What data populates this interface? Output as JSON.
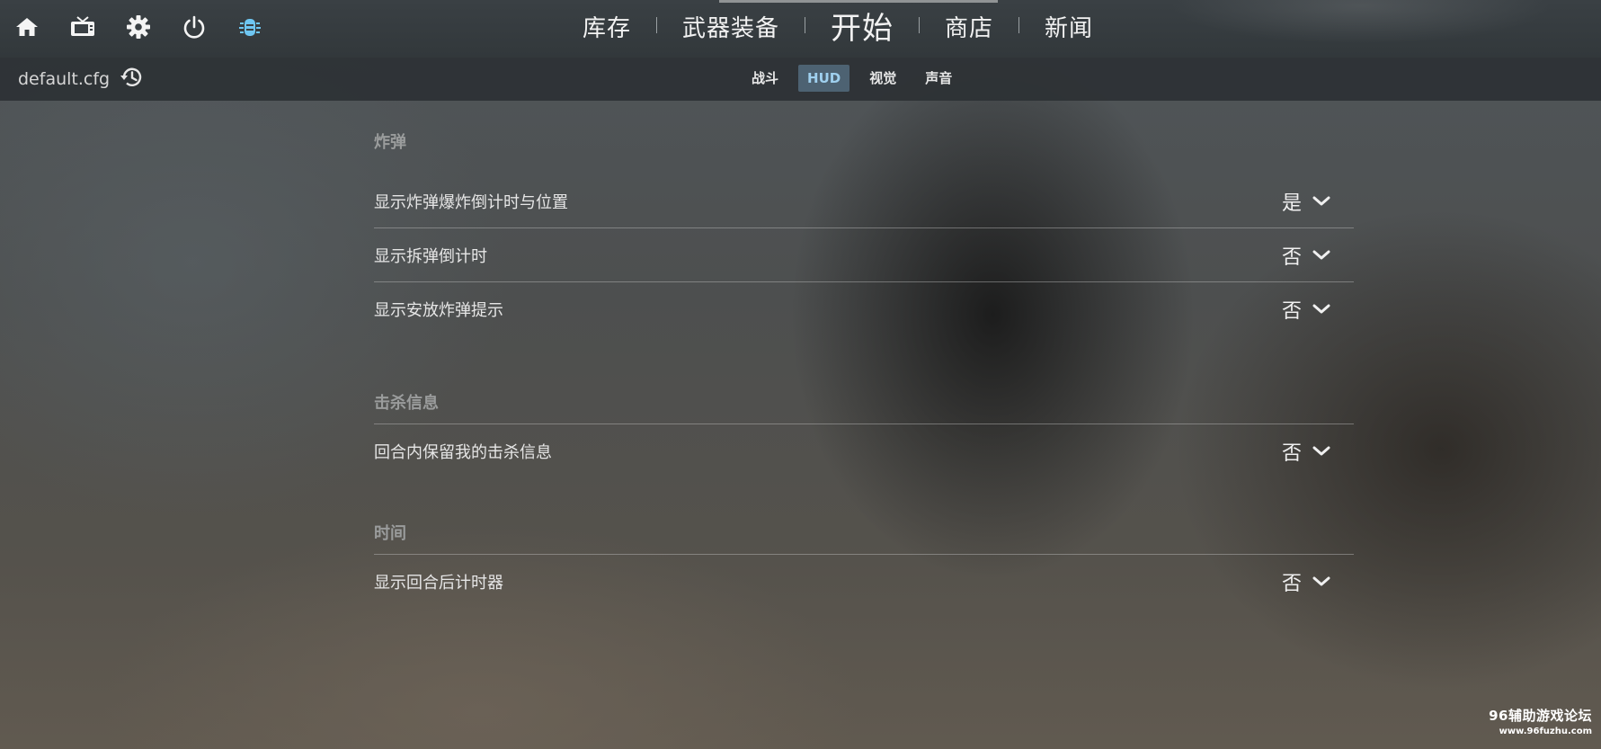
{
  "topbar": {
    "icons": [
      "home-icon",
      "tv-icon",
      "gear-icon",
      "power-icon",
      "bug-icon"
    ],
    "accent_color": "#6ec6f2",
    "nav": [
      {
        "label": "库存"
      },
      {
        "label": "武器装备"
      },
      {
        "label": "开始",
        "active": true
      },
      {
        "label": "商店"
      },
      {
        "label": "新闻"
      }
    ]
  },
  "subbar": {
    "config_name": "default.cfg",
    "tabs": [
      {
        "label": "战斗"
      },
      {
        "label": "HUD",
        "active": true
      },
      {
        "label": "视觉"
      },
      {
        "label": "声音"
      }
    ]
  },
  "sections": [
    {
      "title": "炸弹",
      "rows": [
        {
          "label": "显示炸弹爆炸倒计时与位置",
          "value": "是"
        },
        {
          "label": "显示拆弹倒计时",
          "value": "否"
        },
        {
          "label": "显示安放炸弹提示",
          "value": "否"
        }
      ]
    },
    {
      "title": "击杀信息",
      "rows": [
        {
          "label": "回合内保留我的击杀信息",
          "value": "否"
        }
      ]
    },
    {
      "title": "时间",
      "rows": [
        {
          "label": "显示回合后计时器",
          "value": "否"
        }
      ]
    }
  ],
  "watermark": {
    "line1": "96辅助游戏论坛",
    "line2": "www.96fuzhu.com"
  }
}
